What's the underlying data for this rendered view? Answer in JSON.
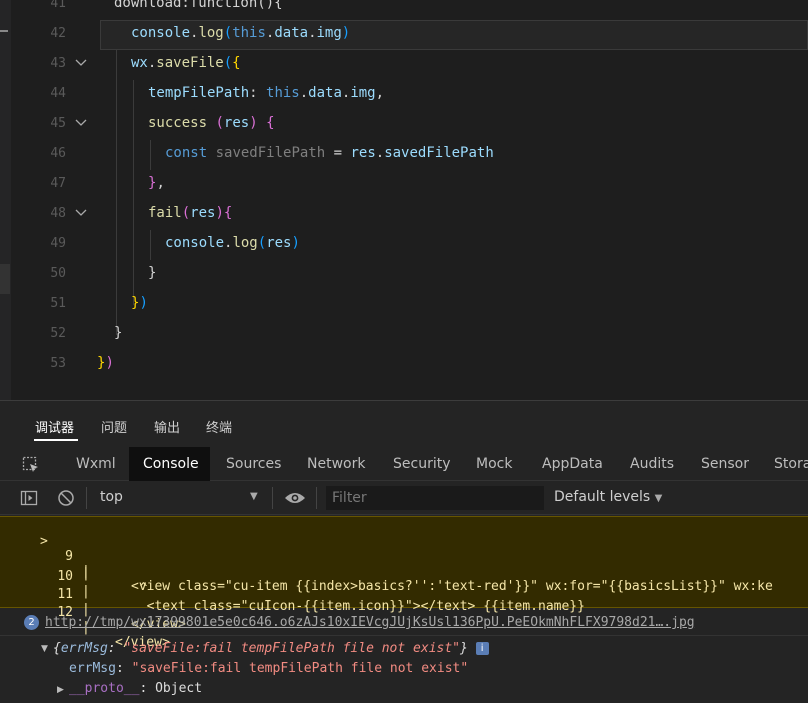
{
  "editor": {
    "lines": [
      {
        "num": "41",
        "text": "download:function(){"
      },
      {
        "num": "42",
        "text": "console.log(this.data.img)"
      },
      {
        "num": "43",
        "text": "wx.saveFile({"
      },
      {
        "num": "44",
        "text": "tempFilePath: this.data.img,"
      },
      {
        "num": "45",
        "text": "success (res) {"
      },
      {
        "num": "46",
        "text": "const savedFilePath = res.savedFilePath"
      },
      {
        "num": "47",
        "text": "},"
      },
      {
        "num": "48",
        "text": "fail(res){"
      },
      {
        "num": "49",
        "text": "console.log(res)"
      },
      {
        "num": "50",
        "text": "}"
      },
      {
        "num": "51",
        "text": "})"
      },
      {
        "num": "52",
        "text": "}"
      },
      {
        "num": "53",
        "text": "})"
      }
    ]
  },
  "devtools": {
    "top_tabs": [
      "调试器",
      "问题",
      "输出",
      "终端"
    ],
    "panel_tabs": [
      "Wxml",
      "Console",
      "Sources",
      "Network",
      "Security",
      "Mock",
      "AppData",
      "Audits",
      "Sensor",
      "Stora"
    ],
    "active_panel_tab": "Console",
    "context": "top",
    "filter_placeholder": "Filter",
    "levels": "Default levels"
  },
  "console": {
    "warning_lines": [
      {
        "marker": ">",
        "num": "9",
        "code": "<view class=\"cu-item {{index>basics?'':'text-red'}}\" wx:for=\"{{basicsList}}\" wx:ke"
      },
      {
        "marker": "",
        "num": "",
        "code": "  ^"
      },
      {
        "marker": "",
        "num": "10",
        "code": "  <text class=\"cuIcon-{{item.icon}}\"></text> {{item.name}}"
      },
      {
        "marker": "",
        "num": "11",
        "code": "</view>"
      },
      {
        "marker": "",
        "num": "12",
        "code": "</view>"
      }
    ],
    "log_count": "2",
    "log_link": "http://tmp/wx17399801e5e0c646.o6zAJs10xIEVcgJUjKsUsl136PpU.PeEOkmNhFLFX9798d21….jpg",
    "object_summary_key": "errMsg",
    "object_summary_value": "\"saveFile:fail tempFilePath file not exist\"",
    "prop_key": "errMsg",
    "prop_value": "\"saveFile:fail tempFilePath file not exist\"",
    "proto_key": "__proto__",
    "proto_value": "Object",
    "info_badge": "i"
  }
}
